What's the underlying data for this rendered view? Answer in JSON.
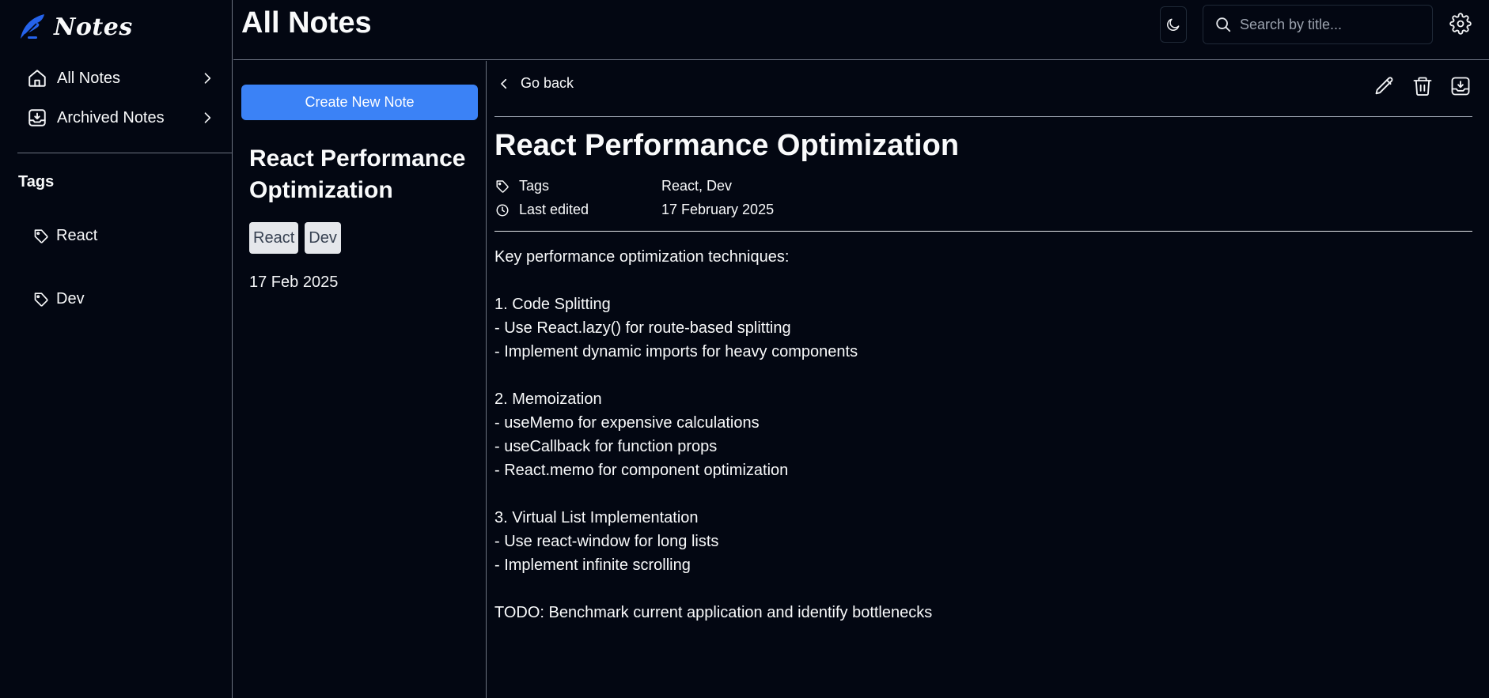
{
  "app": {
    "name": "Notes"
  },
  "sidebar": {
    "items": [
      {
        "label": "All Notes",
        "icon": "home-icon"
      },
      {
        "label": "Archived Notes",
        "icon": "archive-icon"
      }
    ],
    "tags_heading": "Tags",
    "tags": [
      {
        "label": "React"
      },
      {
        "label": "Dev"
      }
    ]
  },
  "header": {
    "title": "All Notes",
    "search_placeholder": "Search by title...",
    "theme_icon": "moon-icon",
    "settings_icon": "gear-icon"
  },
  "note_list": {
    "create_label": "Create New Note",
    "notes": [
      {
        "title": "React Performance Optimization",
        "tags": [
          "React",
          "Dev"
        ],
        "date": "17 Feb 2025"
      }
    ]
  },
  "detail": {
    "back_label": "Go back",
    "actions": [
      "pencil-icon",
      "trash-icon",
      "archive-icon"
    ],
    "title": "React Performance Optimization",
    "tags_label": "Tags",
    "tags_value": "React, Dev",
    "edited_label": "Last edited",
    "edited_value": "17 February 2025",
    "body": "Key performance optimization techniques:\n\n1. Code Splitting\n- Use React.lazy() for route-based splitting\n- Implement dynamic imports for heavy components\n\n2. Memoization\n- useMemo for expensive calculations\n- useCallback for function props\n- React.memo for component optimization\n\n3. Virtual List Implementation\n- Use react-window for long lists\n- Implement infinite scrolling\n\nTODO: Benchmark current application and identify bottlenecks"
  },
  "colors": {
    "background": "#030712",
    "accent": "#3b82f6",
    "logo": "#2563eb",
    "divider": "#6b7280",
    "chip_bg": "#e5e7eb"
  }
}
